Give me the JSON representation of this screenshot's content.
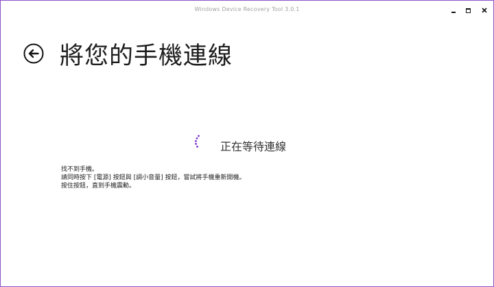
{
  "window": {
    "title": "Windows Device Recovery Tool 3.0.1",
    "accent_color": "#8c4fc9"
  },
  "controls": {
    "minimize_icon": "minimize-icon",
    "maximize_icon": "maximize-icon",
    "close_icon": "close-icon",
    "close_glyph": "✕"
  },
  "header": {
    "back_icon": "back-arrow-icon",
    "title": "將您的手機連線"
  },
  "status": {
    "spinner_icon": "loading-spinner-icon",
    "spinner_color": "#7a2fd0",
    "text": "正在等待連線"
  },
  "help": {
    "line1": "找不到手機。",
    "line2": "請同時按下 [電源] 按鈕與 [調小音量] 按鈕，嘗試將手機重新開機。",
    "line3": "按住按鈕，直到手機震動。"
  }
}
